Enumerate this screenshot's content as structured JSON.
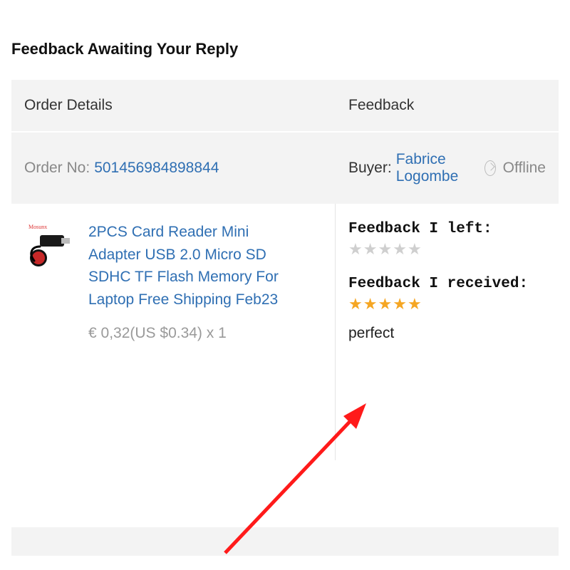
{
  "page_title": "Feedback Awaiting Your Reply",
  "table": {
    "header_order": "Order Details",
    "header_feedback": "Feedback"
  },
  "order": {
    "no_label": "Order No: ",
    "no_value": "501456984898844"
  },
  "buyer": {
    "label": "Buyer: ",
    "name": "Fabrice Logombe",
    "status": "Offline"
  },
  "product": {
    "brand": "Mosunx",
    "title": "2PCS Card Reader Mini Adapter USB 2.0 Micro SD SDHC TF Flash Memory For Laptop Free Shipping Feb23",
    "price": "€ 0,32(US $0.34) x 1"
  },
  "feedback": {
    "left_label": "Feedback I left:",
    "received_label": "Feedback I received:",
    "received_text": "perfect",
    "left_stars": 0,
    "received_stars": 5
  }
}
